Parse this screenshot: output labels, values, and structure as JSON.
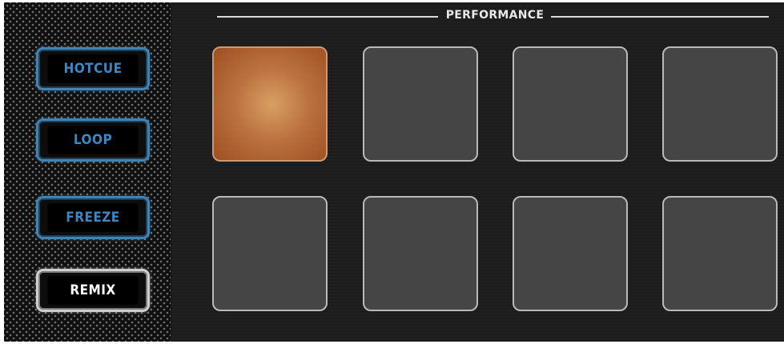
{
  "section_title": "PERFORMANCE",
  "mode_buttons": [
    {
      "label": "HOTCUE",
      "state": "available",
      "color": "#3d86bf"
    },
    {
      "label": "LOOP",
      "state": "available",
      "color": "#3d86bf"
    },
    {
      "label": "FREEZE",
      "state": "available",
      "color": "#3d86bf"
    },
    {
      "label": "REMIX",
      "state": "selected",
      "color": "#ffffff"
    }
  ],
  "pads": [
    {
      "index": 1,
      "lit": true,
      "color": "#c07a45"
    },
    {
      "index": 2,
      "lit": false
    },
    {
      "index": 3,
      "lit": false
    },
    {
      "index": 4,
      "lit": false
    },
    {
      "index": 5,
      "lit": false
    },
    {
      "index": 6,
      "lit": false
    },
    {
      "index": 7,
      "lit": false
    },
    {
      "index": 8,
      "lit": false
    }
  ]
}
